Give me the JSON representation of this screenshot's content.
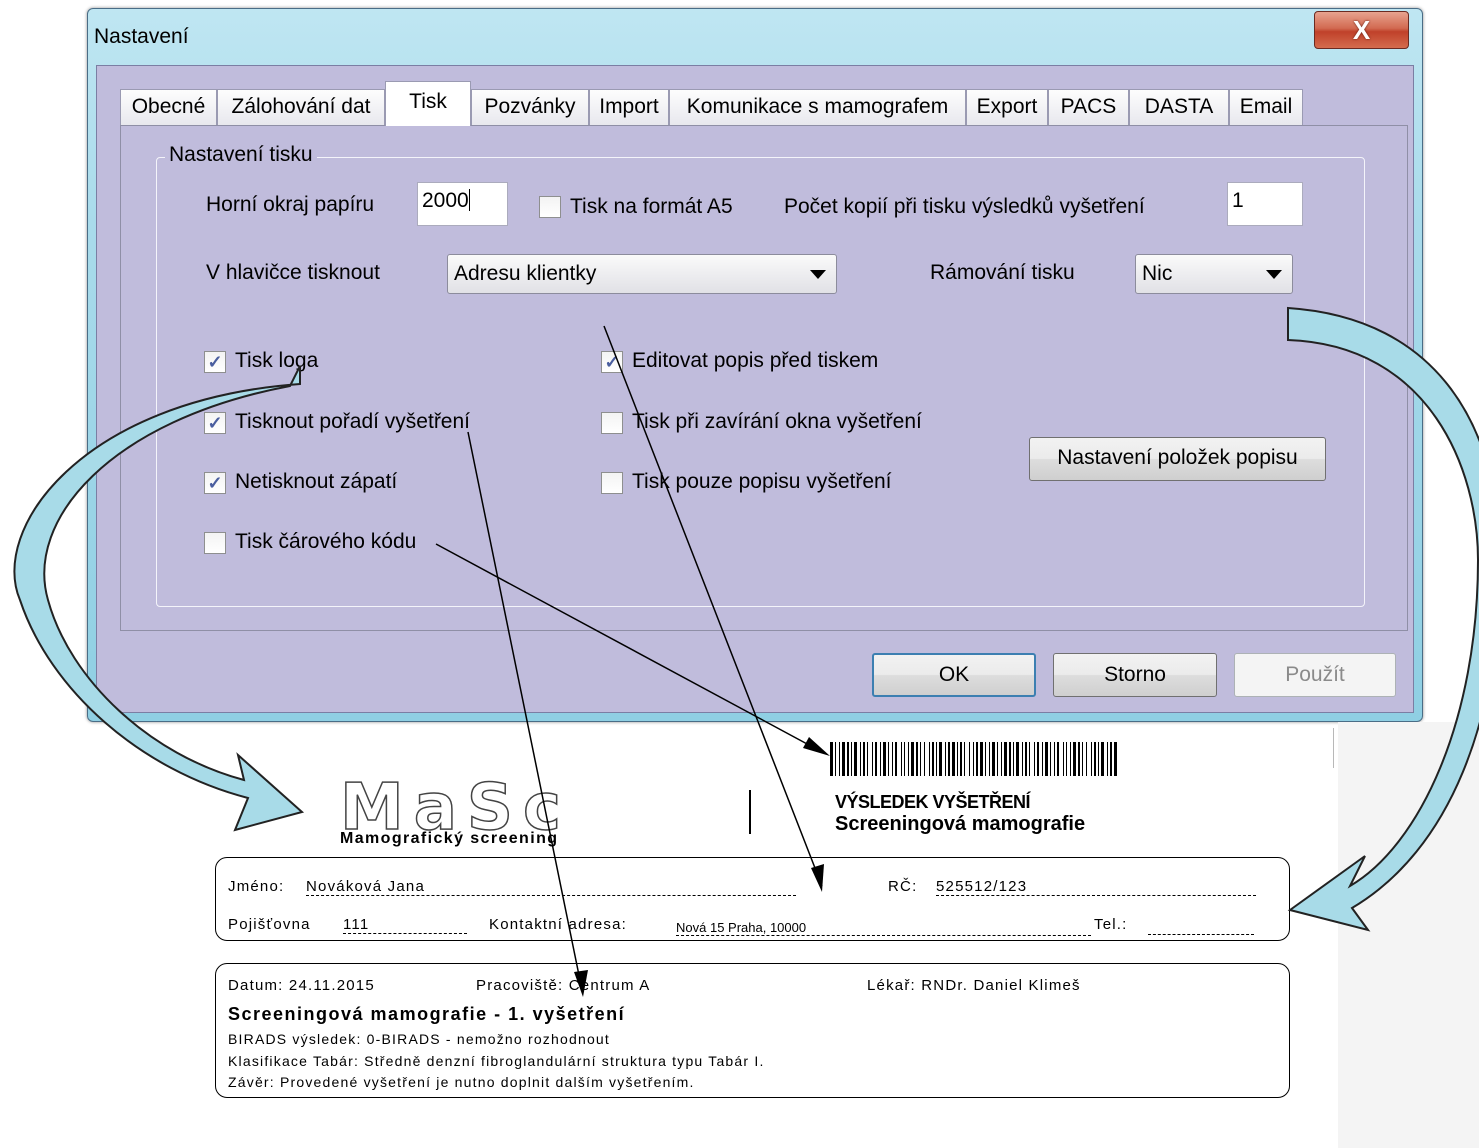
{
  "window": {
    "title": "Nastavení",
    "close_glyph": "X"
  },
  "tabs": [
    {
      "label": "Obecné",
      "active": false
    },
    {
      "label": "Zálohování dat",
      "active": false
    },
    {
      "label": "Tisk",
      "active": true
    },
    {
      "label": "Pozvánky",
      "active": false
    },
    {
      "label": "Import",
      "active": false
    },
    {
      "label": "Komunikace s mamografem",
      "active": false
    },
    {
      "label": "Export",
      "active": false
    },
    {
      "label": "PACS",
      "active": false
    },
    {
      "label": "DASTA",
      "active": false
    },
    {
      "label": "Email",
      "active": false
    }
  ],
  "print_settings": {
    "group_title": "Nastavení tisku",
    "top_margin_label": "Horní okraj papíru",
    "top_margin_value": "2000",
    "a5_label": "Tisk na formát A5",
    "a5_checked": false,
    "copies_label": "Počet kopií při tisku výsledků vyšetření",
    "copies_value": "1",
    "header_label": "V hlavičce tisknout",
    "header_value": "Adresu klientky",
    "frame_label": "Rámování tisku",
    "frame_value": "Nic",
    "checkboxes": [
      {
        "label": "Tisk loga",
        "checked": true
      },
      {
        "label": "Tisknout pořadí vyšetření",
        "checked": true
      },
      {
        "label": "Netisknout zápatí",
        "checked": true
      },
      {
        "label": "Tisk čárového kódu",
        "checked": false
      },
      {
        "label": "Editovat popis před tiskem",
        "checked": true
      },
      {
        "label": "Tisk při zavírání okna vyšetření",
        "checked": false
      },
      {
        "label": "Tisk pouze popisu vyšetření",
        "checked": false
      }
    ],
    "items_button": "Nastavení položek popisu"
  },
  "buttons": {
    "ok": "OK",
    "cancel": "Storno",
    "apply": "Použít"
  },
  "report": {
    "logo_text": "MaSc",
    "logo_subtitle": "Mamografický screening",
    "result_title": "VÝSLEDEK VYŠETŘENÍ",
    "result_subtitle": "Screeningová mamografie",
    "name_label": "Jméno:",
    "name_value": "Nováková Jana",
    "rc_label": "RČ:",
    "rc_value": "525512/123",
    "insurance_label": "Pojišťovna",
    "insurance_value": "111",
    "contact_label": "Kontaktní adresa:",
    "contact_value": "Nová 15 Praha, 10000",
    "tel_label": "Tel.:",
    "date_text": "Datum: 24.11.2015",
    "workplace_text": "Pracoviště: Centrum A",
    "doctor_text": "Lékař: RNDr. Daniel Klimeš",
    "exam_title": "Screeningová mamografie - 1. vyšetření",
    "birads_text": "BIRADS výsledek:  0-BIRADS - nemožno rozhodnout",
    "tabar_text": "Klasifikace Tabár:  Středně denzní fibroglandulární struktura typu Tabár I.",
    "conclusion_text": "Závěr: Provedené vyšetření je nutno doplnit dalším vyšetřením."
  },
  "colors": {
    "dialog_bg": "#c0bcdc",
    "window_frame": "#a9dbeb",
    "arrow_fill": "#a8dbe8",
    "close_button": "#c0412a"
  }
}
